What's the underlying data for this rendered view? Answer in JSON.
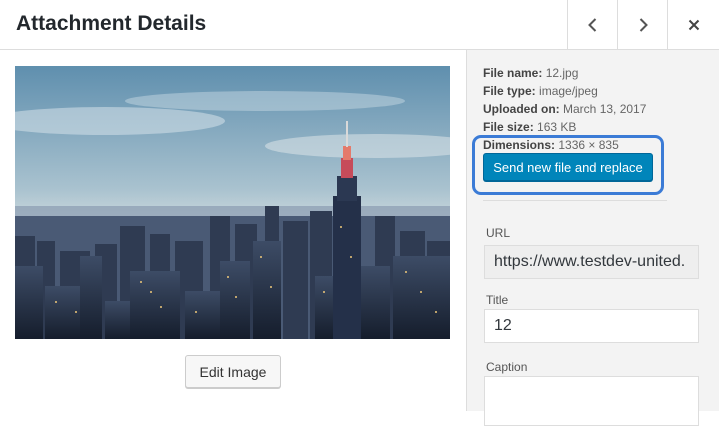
{
  "header": {
    "title": "Attachment Details",
    "prev_icon": "chevron-left-icon",
    "next_icon": "chevron-right-icon",
    "close_icon": "close-icon"
  },
  "left": {
    "edit_button_label": "Edit Image"
  },
  "details": {
    "file_name_label": "File name:",
    "file_name": "12.jpg",
    "file_type_label": "File type:",
    "file_type": "image/jpeg",
    "uploaded_label": "Uploaded on:",
    "uploaded": "March 13, 2017",
    "file_size_label": "File size:",
    "file_size": "163 KB",
    "dimensions_label": "Dimensions:",
    "dimensions": "1336 × 835",
    "replace_button_label": "Send new file and replace"
  },
  "fields": {
    "url_label": "URL",
    "url_value": "https://www.testdev-united.",
    "title_label": "Title",
    "title_value": "12",
    "caption_label": "Caption",
    "caption_value": ""
  },
  "colors": {
    "primary_button": "#0085ba",
    "highlight_outline": "#3b7bd6",
    "sidebar_bg": "#f3f3f3"
  }
}
